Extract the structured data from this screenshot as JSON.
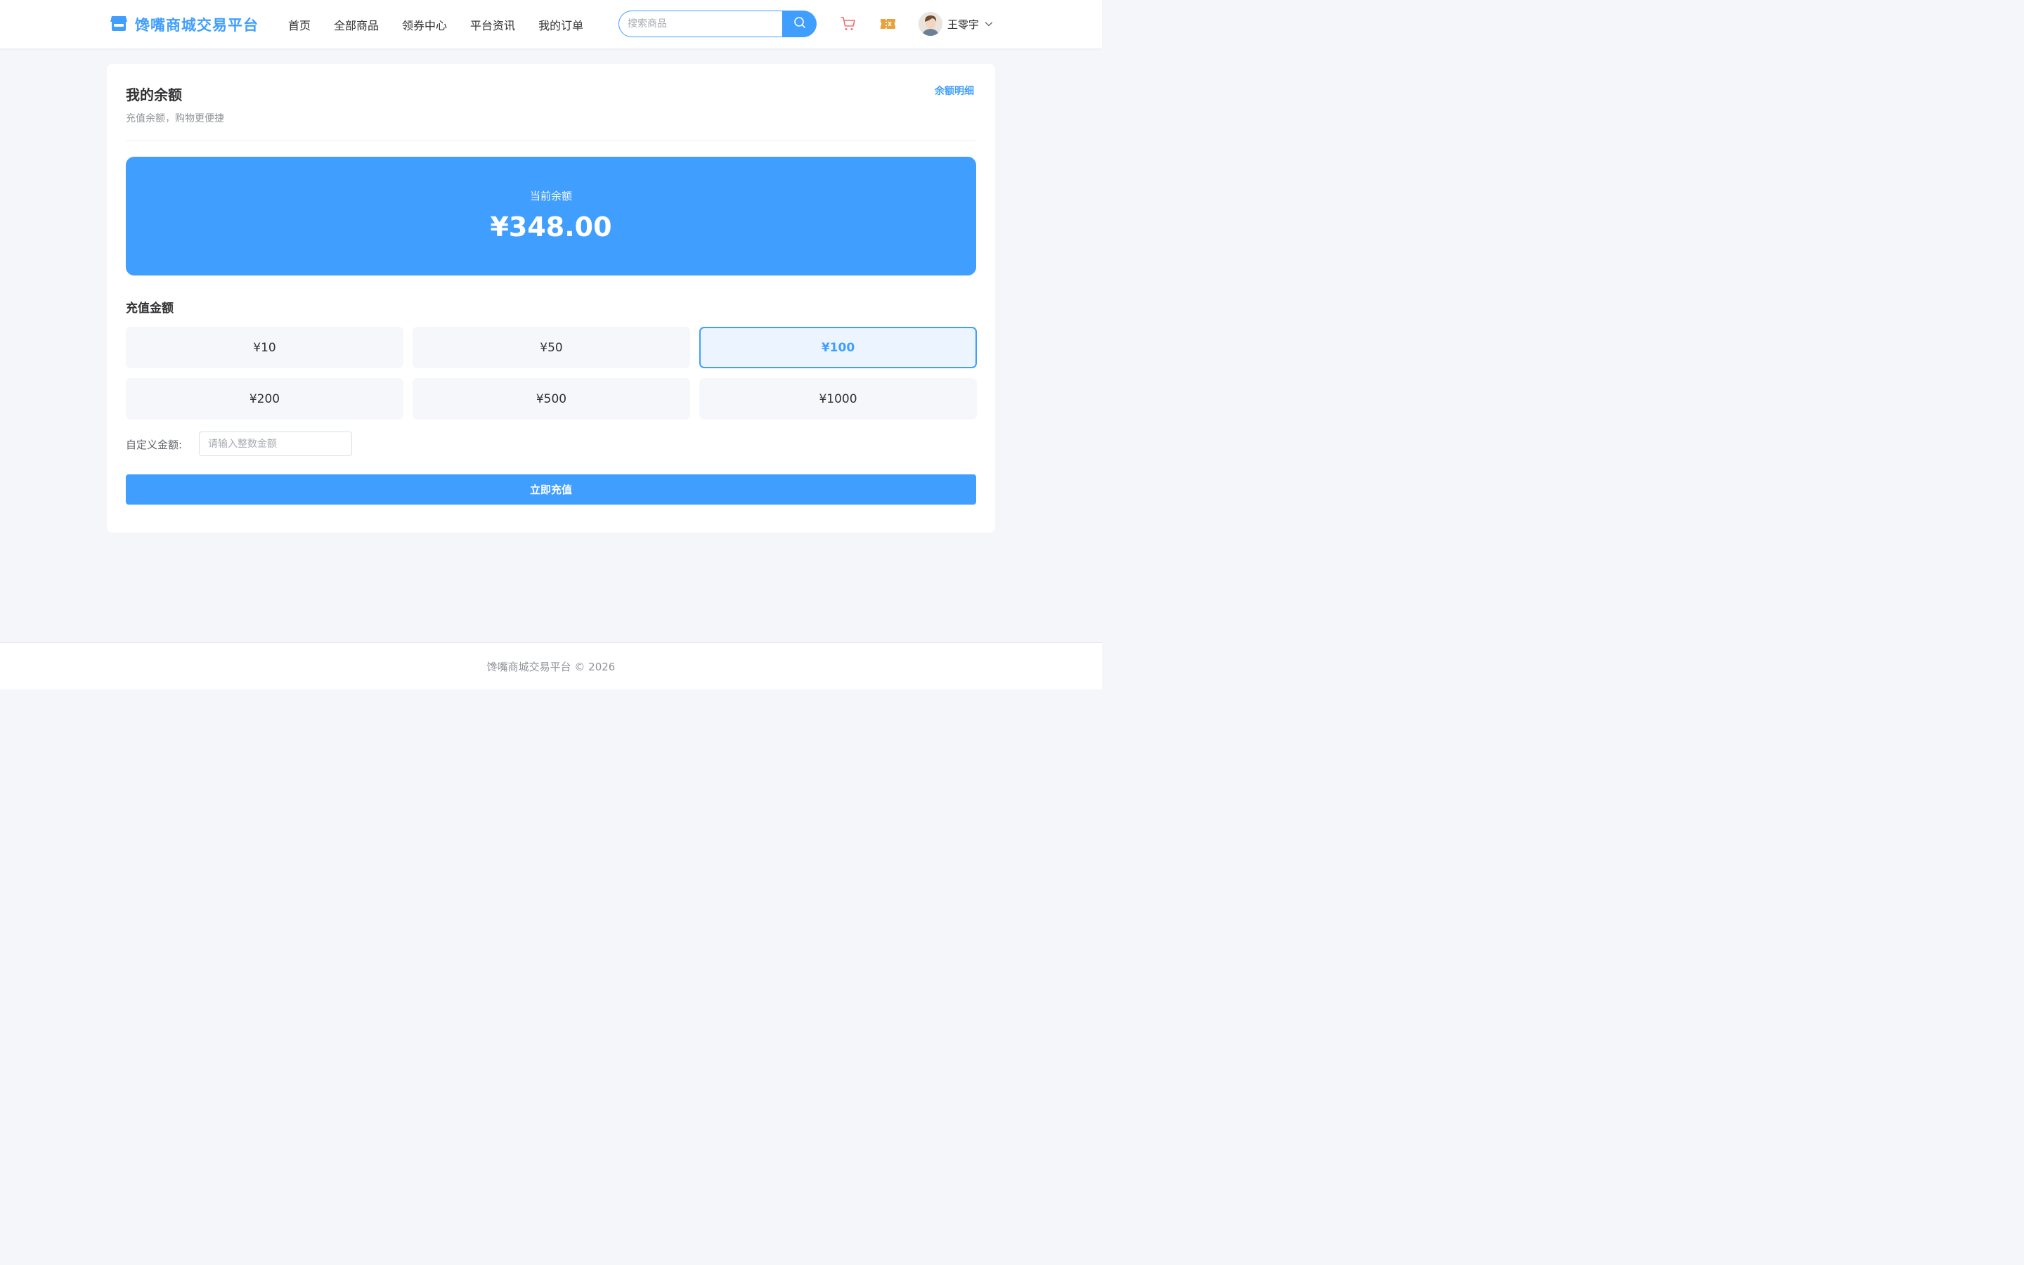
{
  "brand": {
    "name": "馋嘴商城交易平台",
    "logo_icon": "shop-icon",
    "color": "#409eff"
  },
  "nav": {
    "items": [
      {
        "label": "首页"
      },
      {
        "label": "全部商品"
      },
      {
        "label": "领券中心"
      },
      {
        "label": "平台资讯"
      },
      {
        "label": "我的订单"
      }
    ]
  },
  "search": {
    "placeholder": "搜索商品",
    "value": "",
    "icon": "search-icon"
  },
  "header_icons": {
    "cart": "cart-icon",
    "cart_color": "#f56c6c",
    "coupon": "coupon-icon",
    "coupon_color": "#e6a23c"
  },
  "user": {
    "name": "王零宇",
    "dropdown_icon": "chevron-down-icon"
  },
  "page": {
    "title": "我的余额",
    "subtitle": "充值余额，购物更便捷",
    "detail_link": "余额明细"
  },
  "balance": {
    "label": "当前余额",
    "amount": "¥348.00"
  },
  "recharge": {
    "section_title": "充值金额",
    "options": [
      {
        "label": "¥10",
        "selected": false
      },
      {
        "label": "¥50",
        "selected": false
      },
      {
        "label": "¥100",
        "selected": true
      },
      {
        "label": "¥200",
        "selected": false
      },
      {
        "label": "¥500",
        "selected": false
      },
      {
        "label": "¥1000",
        "selected": false
      }
    ],
    "custom_label": "自定义金额:",
    "custom_placeholder": "请输入整数金额",
    "custom_value": "",
    "submit_label": "立即充值"
  },
  "footer": {
    "text": "馋嘴商城交易平台 © 2026"
  }
}
